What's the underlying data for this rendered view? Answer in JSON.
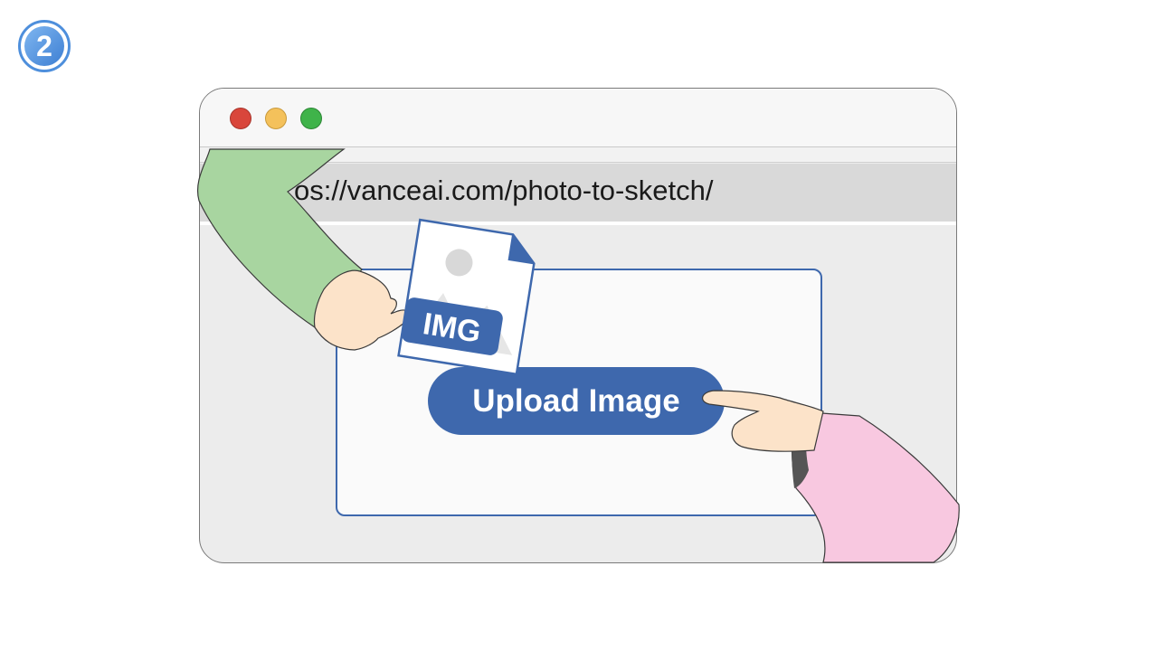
{
  "step": {
    "number": "2"
  },
  "browser": {
    "url": "os://vanceai.com/photo-to-sketch/",
    "window_controls": [
      {
        "name": "close",
        "color": "#d9463b"
      },
      {
        "name": "minimize",
        "color": "#f4c15b"
      },
      {
        "name": "maximize",
        "color": "#3fb34a"
      }
    ]
  },
  "upload": {
    "button_label": "Upload Image",
    "file_badge": "IMG"
  },
  "colors": {
    "accent": "#3e68ad",
    "left_sleeve": "#a8d5a0",
    "right_sleeve": "#f8c8e0",
    "skin": "#fce3c9"
  }
}
